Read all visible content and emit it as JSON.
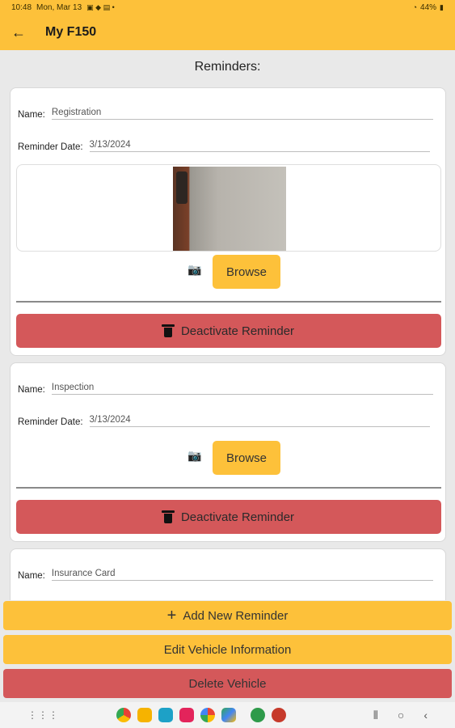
{
  "status_bar": {
    "time": "10:48",
    "date": "Mon, Mar 13",
    "battery": "44%"
  },
  "app_bar": {
    "back_icon": "arrow-left-icon",
    "title": "My F150"
  },
  "section_title": "Reminders:",
  "reminders": [
    {
      "name_label": "Name:",
      "name_value": "Registration",
      "date_label": "Reminder Date:",
      "date_value": "3/13/2024",
      "has_photo": true,
      "browse_label": "Browse",
      "deactivate_label": "Deactivate Reminder"
    },
    {
      "name_label": "Name:",
      "name_value": "Inspection",
      "date_label": "Reminder Date:",
      "date_value": "3/13/2024",
      "has_photo": false,
      "browse_label": "Browse",
      "deactivate_label": "Deactivate Reminder"
    },
    {
      "name_label": "Name:",
      "name_value": "Insurance Card"
    }
  ],
  "actions": {
    "add_label": "Add New Reminder",
    "edit_label": "Edit Vehicle Information",
    "delete_label": "Delete Vehicle"
  },
  "colors": {
    "accent_yellow": "#fdc13a",
    "danger_red": "#d4585a",
    "background": "#e9e9e9"
  },
  "nav_dock_icons": [
    "chrome-icon",
    "files-icon",
    "calendar-icon",
    "media-icon",
    "photos-icon",
    "play-store-icon",
    "app-icon",
    "app-icon"
  ]
}
